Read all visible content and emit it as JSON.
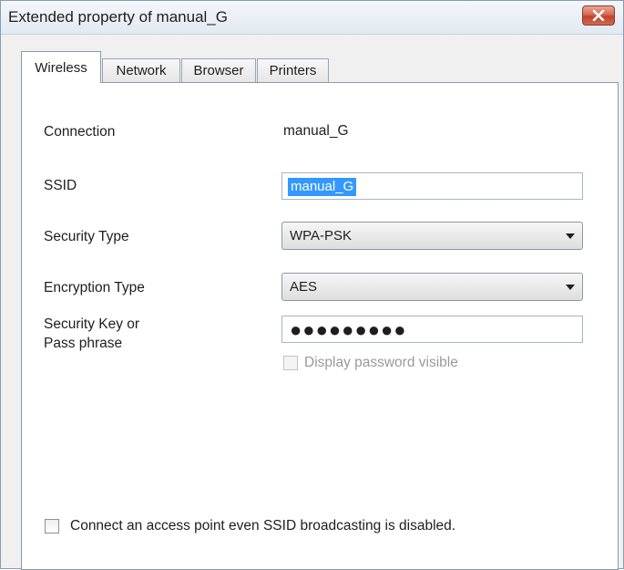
{
  "window": {
    "title": "Extended property of manual_G"
  },
  "tabs": [
    {
      "label": "Wireless",
      "active": true
    },
    {
      "label": "Network",
      "active": false
    },
    {
      "label": "Browser",
      "active": false
    },
    {
      "label": "Printers",
      "active": false
    }
  ],
  "wireless": {
    "connection": {
      "label": "Connection",
      "value": "manual_G"
    },
    "ssid": {
      "label": "SSID",
      "value": "manual_G"
    },
    "security_type": {
      "label": "Security Type",
      "value": "WPA-PSK"
    },
    "encryption_type": {
      "label": "Encryption Type",
      "value": "AES"
    },
    "security_key": {
      "label_line1": "Security Key or",
      "label_line2": "Pass phrase",
      "masked_value": "●●●●●●●●●"
    },
    "display_password": {
      "label": "Display password visible",
      "checked": false,
      "enabled": false
    },
    "hidden_ssid": {
      "label": "Connect an access point even SSID broadcasting is disabled.",
      "checked": false
    }
  },
  "icons": {
    "close": "close-icon"
  },
  "colors": {
    "selection": "#3399ff",
    "close_button": "#c1432c"
  }
}
